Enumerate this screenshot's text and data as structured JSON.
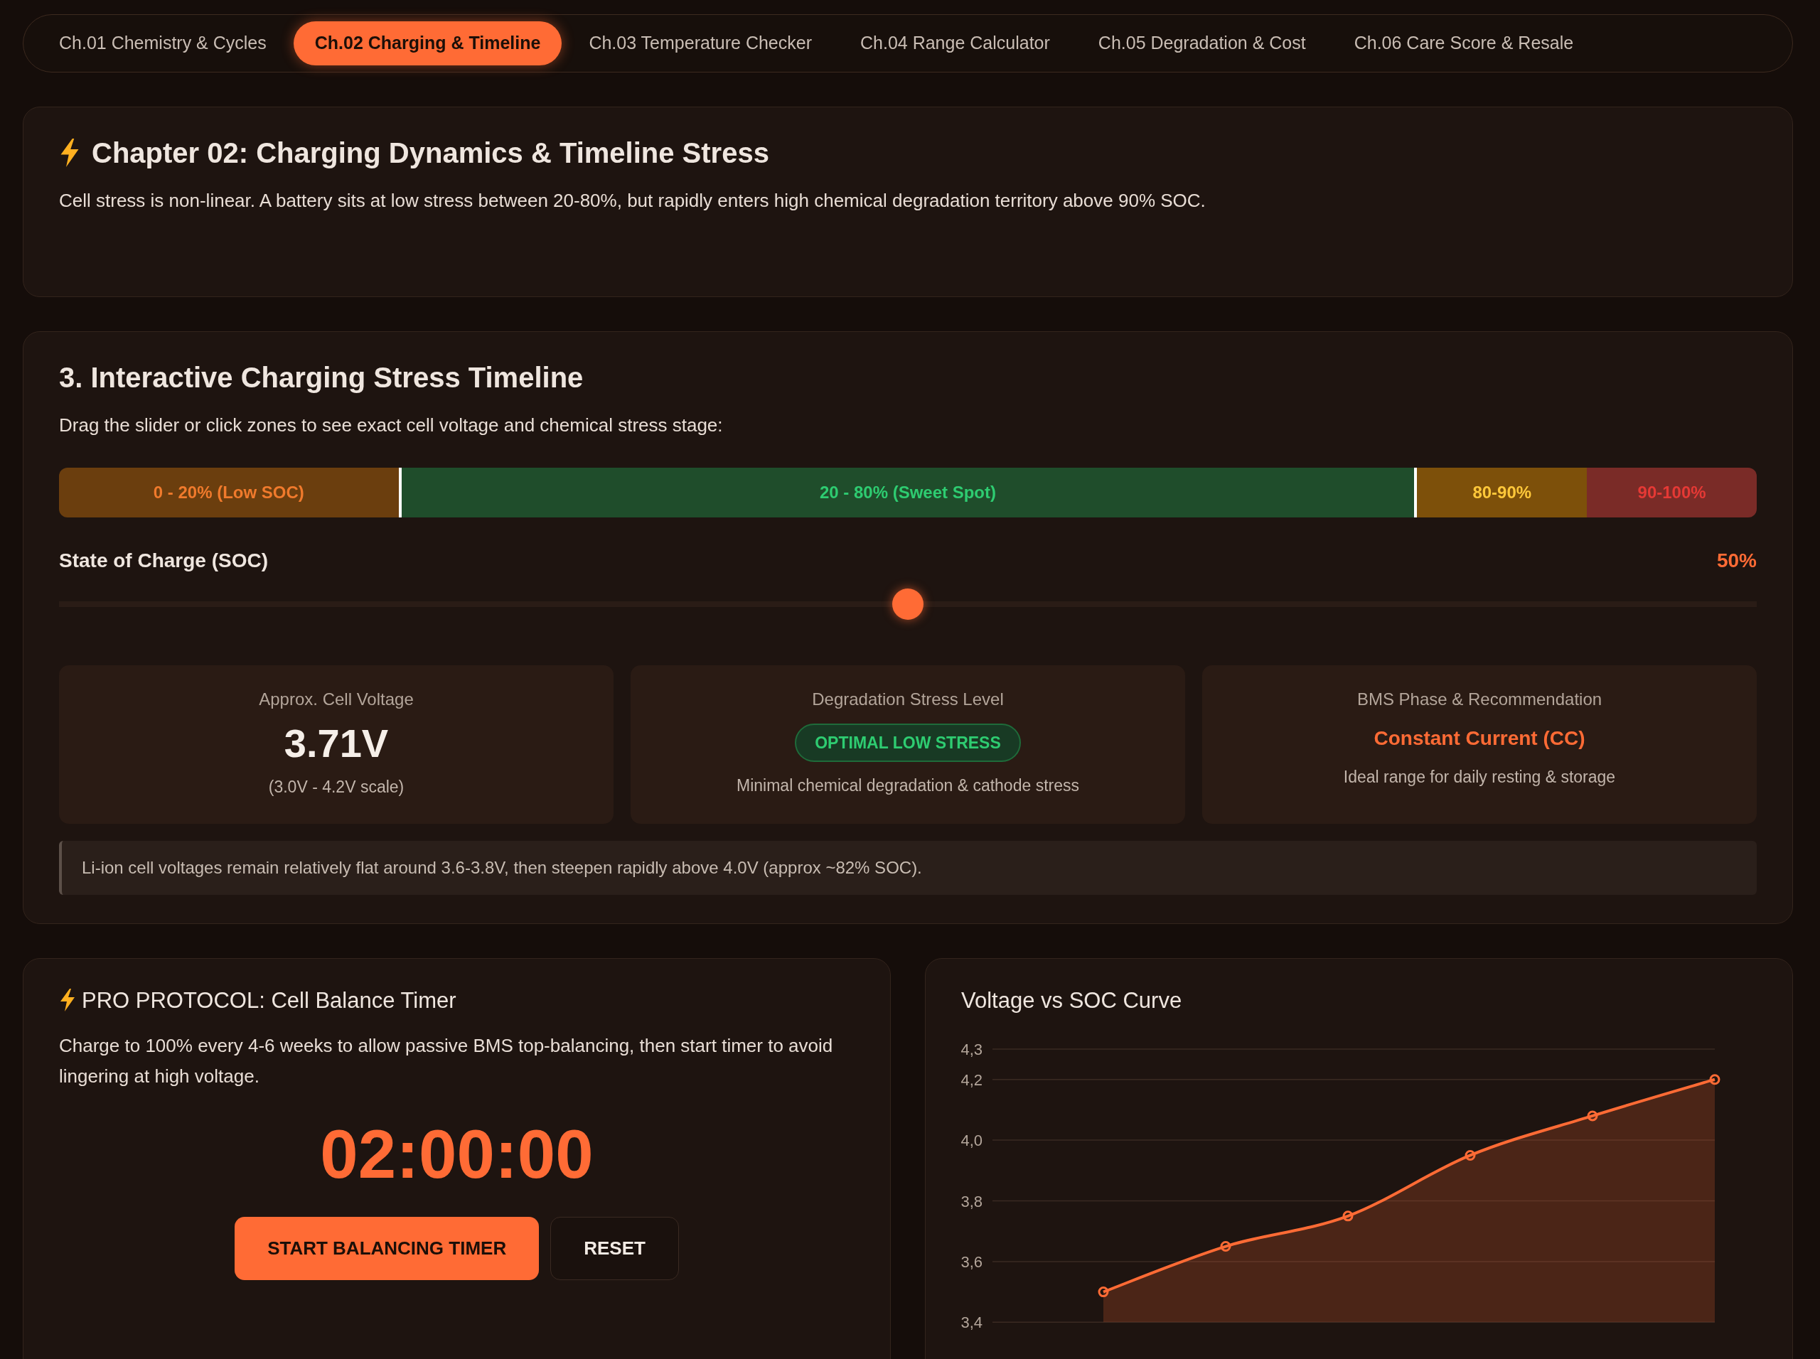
{
  "tabs": [
    {
      "label": "Ch.01 Chemistry & Cycles",
      "selected": false
    },
    {
      "label": "Ch.02 Charging & Timeline",
      "selected": true
    },
    {
      "label": "Ch.03 Temperature Checker",
      "selected": false
    },
    {
      "label": "Ch.04 Range Calculator",
      "selected": false
    },
    {
      "label": "Ch.05 Degradation & Cost",
      "selected": false
    },
    {
      "label": "Ch.06 Care Score & Resale",
      "selected": false
    }
  ],
  "intro": {
    "title": "Chapter 02: Charging Dynamics & Timeline Stress",
    "text": "Cell stress is non-linear. A battery sits at low stress between 20-80%, but rapidly enters high chemical degradation territory above 90% SOC."
  },
  "timeline": {
    "title": "3. Interactive Charging Stress Timeline",
    "instructions": "Drag the slider or click zones to see exact cell voltage and chemical stress stage:",
    "zones": [
      {
        "label": "0 - 20% (Low SOC)",
        "kind": "low",
        "selected": false
      },
      {
        "label": "20 - 80% (Sweet Spot)",
        "kind": "sweet",
        "selected": true
      },
      {
        "label": "80-90%",
        "kind": "high",
        "selected": false
      },
      {
        "label": "90-100%",
        "kind": "critical",
        "selected": false
      }
    ],
    "slider": {
      "label": "State of Charge (SOC)",
      "reading": "50%",
      "level": 0.5
    },
    "stats": [
      {
        "kind": "voltage",
        "title": "Approx. Cell Voltage",
        "value": "3.71V",
        "note": "(3.0V - 4.2V scale)"
      },
      {
        "kind": "stress",
        "title": "Degradation Stress Level",
        "badge": "OPTIMAL LOW STRESS",
        "note": "Minimal chemical degradation & cathode stress"
      },
      {
        "kind": "phase",
        "title": "BMS Phase & Recommendation",
        "value": "Constant Current (CC)",
        "note": "Ideal range for daily resting & storage"
      }
    ],
    "footnote": "Li-ion cell voltages remain relatively flat around 3.6-3.8V, then steepen rapidly above 4.0V (approx ~82% SOC)."
  },
  "timer": {
    "title": "PRO PROTOCOL: Cell Balance Timer",
    "text": "Charge to 100% every 4-6 weeks to allow passive BMS top-balancing, then start timer to avoid lingering at high voltage.",
    "time": "02:00:00",
    "buttons": [
      {
        "label": "START BALANCING TIMER",
        "kind": "primary"
      },
      {
        "label": "RESET",
        "kind": "secondary"
      }
    ]
  },
  "curve": {
    "title": "Voltage vs SOC Curve",
    "chart_data": {
      "type": "area",
      "ylim": [
        3.4,
        4.3
      ],
      "grid": true,
      "yticks": [
        {
          "value": 3.4,
          "label": "3,4"
        },
        {
          "value": 3.6,
          "label": "3,6"
        },
        {
          "value": 3.8,
          "label": "3,8"
        },
        {
          "value": 4.0,
          "label": "4,0"
        },
        {
          "value": 4.2,
          "label": "4,2"
        },
        {
          "value": 4.3,
          "label": "4,3"
        }
      ],
      "series": [
        {
          "color": "#ff6b35",
          "values": [
            null,
            3.5,
            3.65,
            3.75,
            3.95,
            4.08,
            4.2
          ]
        }
      ]
    }
  }
}
